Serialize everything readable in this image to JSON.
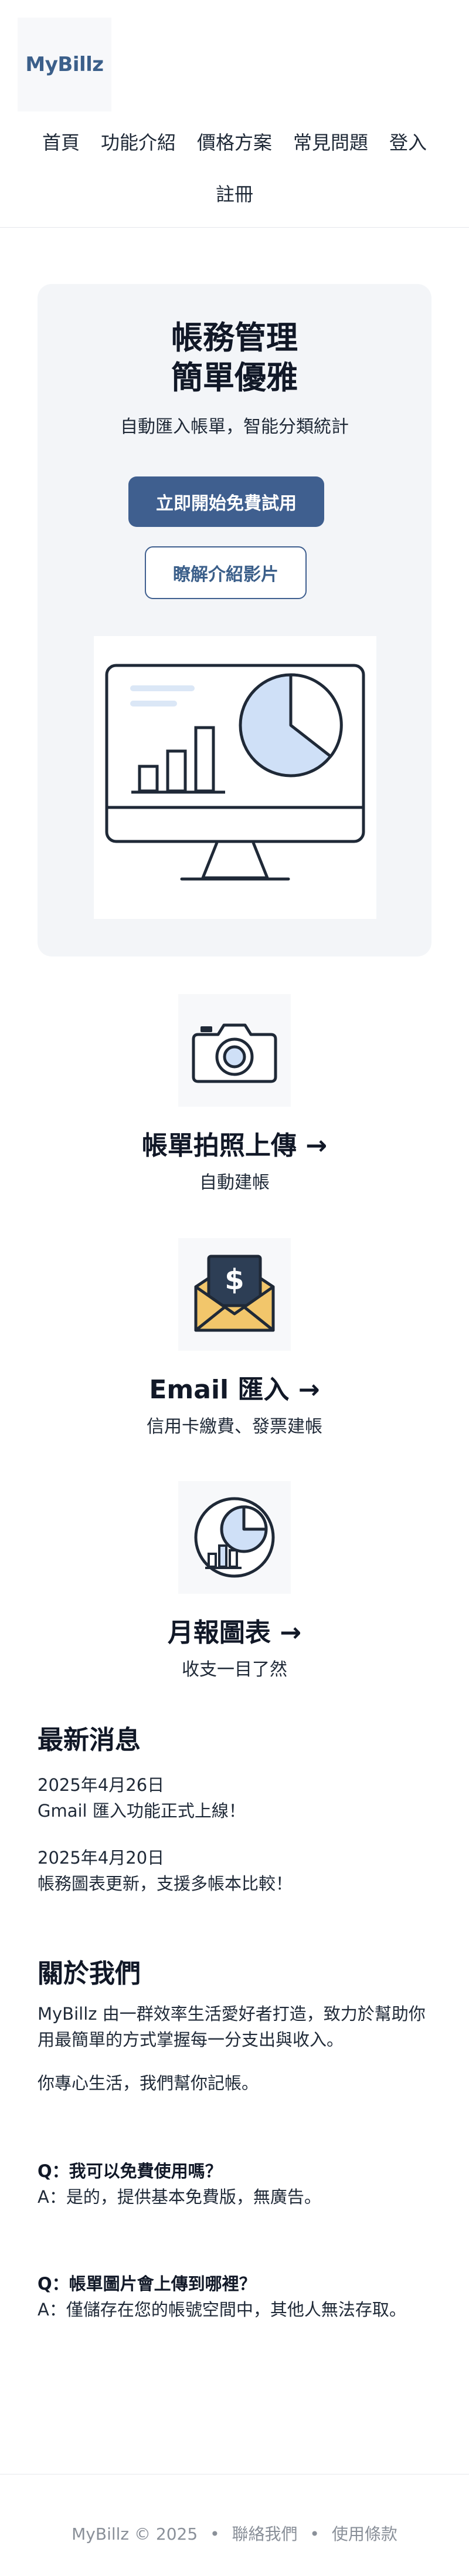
{
  "brand": {
    "logo_text": "MyBillz"
  },
  "nav": {
    "items": [
      "首頁",
      "功能介紹",
      "價格方案",
      "常見問題",
      "登入",
      "註冊"
    ]
  },
  "hero": {
    "title_line1": "帳務管理",
    "title_line2": "簡單優雅",
    "subtitle": "自動匯入帳單，智能分類統計",
    "primary_cta": "立即開始免費試用",
    "secondary_cta": "瞭解介紹影片"
  },
  "features": [
    {
      "title": "帳單拍照上傳 →",
      "desc": "自動建帳",
      "icon": "camera-icon"
    },
    {
      "title": "Email 匯入 →",
      "desc": "信用卡繳費、發票建帳",
      "icon": "email-dollar-icon"
    },
    {
      "title": "月報圖表 →",
      "desc": "收支一目了然",
      "icon": "pie-chart-icon"
    }
  ],
  "news": {
    "title": "最新消息",
    "items": [
      {
        "date": "2025年4月26日",
        "text": "Gmail 匯入功能正式上線！"
      },
      {
        "date": "2025年4月20日",
        "text": "帳務圖表更新，支援多帳本比較！"
      }
    ]
  },
  "about": {
    "title": "關於我們",
    "p1": "MyBillz 由一群效率生活愛好者打造，致力於幫助你用最簡單的方式掌握每一分支出與收入。",
    "p2": "你專心生活，我們幫你記帳。"
  },
  "faq": [
    {
      "q": "Q：我可以免費使用嗎？",
      "a": "A：是的，提供基本免費版，無廣告。"
    },
    {
      "q": "Q：帳單圖片會上傳到哪裡？",
      "a": "A：僅儲存在您的帳號空間中，其他人無法存取。"
    }
  ],
  "footer": {
    "copyright": "MyBillz © 2025",
    "separator": "•",
    "contact": "聯絡我們",
    "terms": "使用條款"
  },
  "colors": {
    "accent": "#3f5f8f",
    "hero_bg": "#f3f5f8",
    "icon_fill": "#cfe0f7",
    "envelope": "#f2c66b"
  }
}
